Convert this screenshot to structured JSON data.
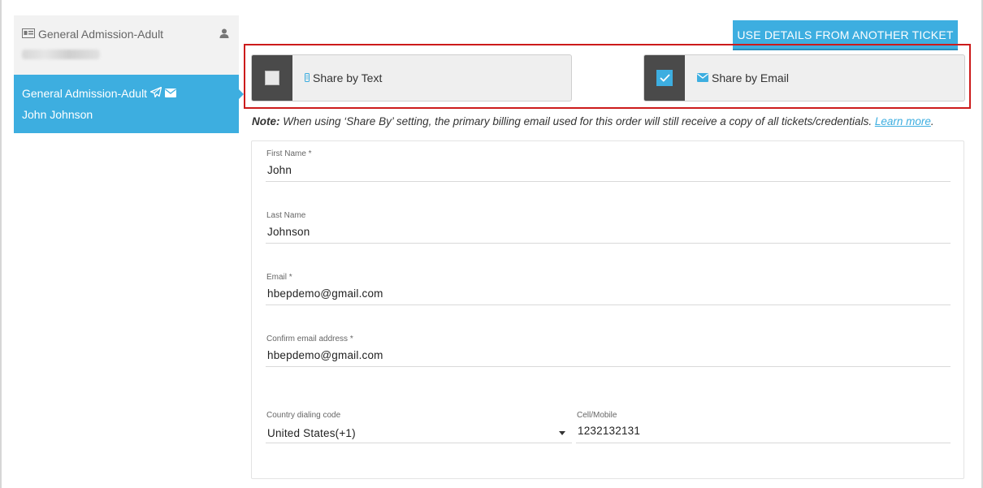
{
  "sidebar": {
    "tickets": [
      {
        "title": "General Admission-Adult",
        "subtitle_blurred": true,
        "active": false
      },
      {
        "title": "General Admission-Adult",
        "holder": "John Johnson",
        "active": true
      }
    ]
  },
  "header": {
    "use_details_button": "USE DETAILS FROM ANOTHER TICKET"
  },
  "share": {
    "text": {
      "label": "Share by Text",
      "checked": false,
      "icon": "mobile-icon"
    },
    "email": {
      "label": "Share by Email",
      "checked": true,
      "icon": "envelope-icon"
    }
  },
  "note": {
    "prefix": "Note:",
    "text": " When using ‘Share By’ setting, the primary billing email used for this order will still receive a copy of all tickets/credentials. ",
    "link": "Learn more",
    "suffix": "."
  },
  "form": {
    "first_name": {
      "label": "First Name *",
      "value": "John"
    },
    "last_name": {
      "label": "Last Name",
      "value": "Johnson"
    },
    "email": {
      "label": "Email *",
      "value": "hbepdemo@gmail.com"
    },
    "confirm_email": {
      "label": "Confirm email address *",
      "value": "hbepdemo@gmail.com"
    },
    "country_code": {
      "label": "Country dialing code",
      "value": "United States(+1)"
    },
    "cell": {
      "label": "Cell/Mobile",
      "value": "1232132131"
    }
  },
  "colors": {
    "accent": "#3daee0",
    "highlight": "#cc1b1b",
    "checkbox_zone": "#4a4a4a"
  }
}
